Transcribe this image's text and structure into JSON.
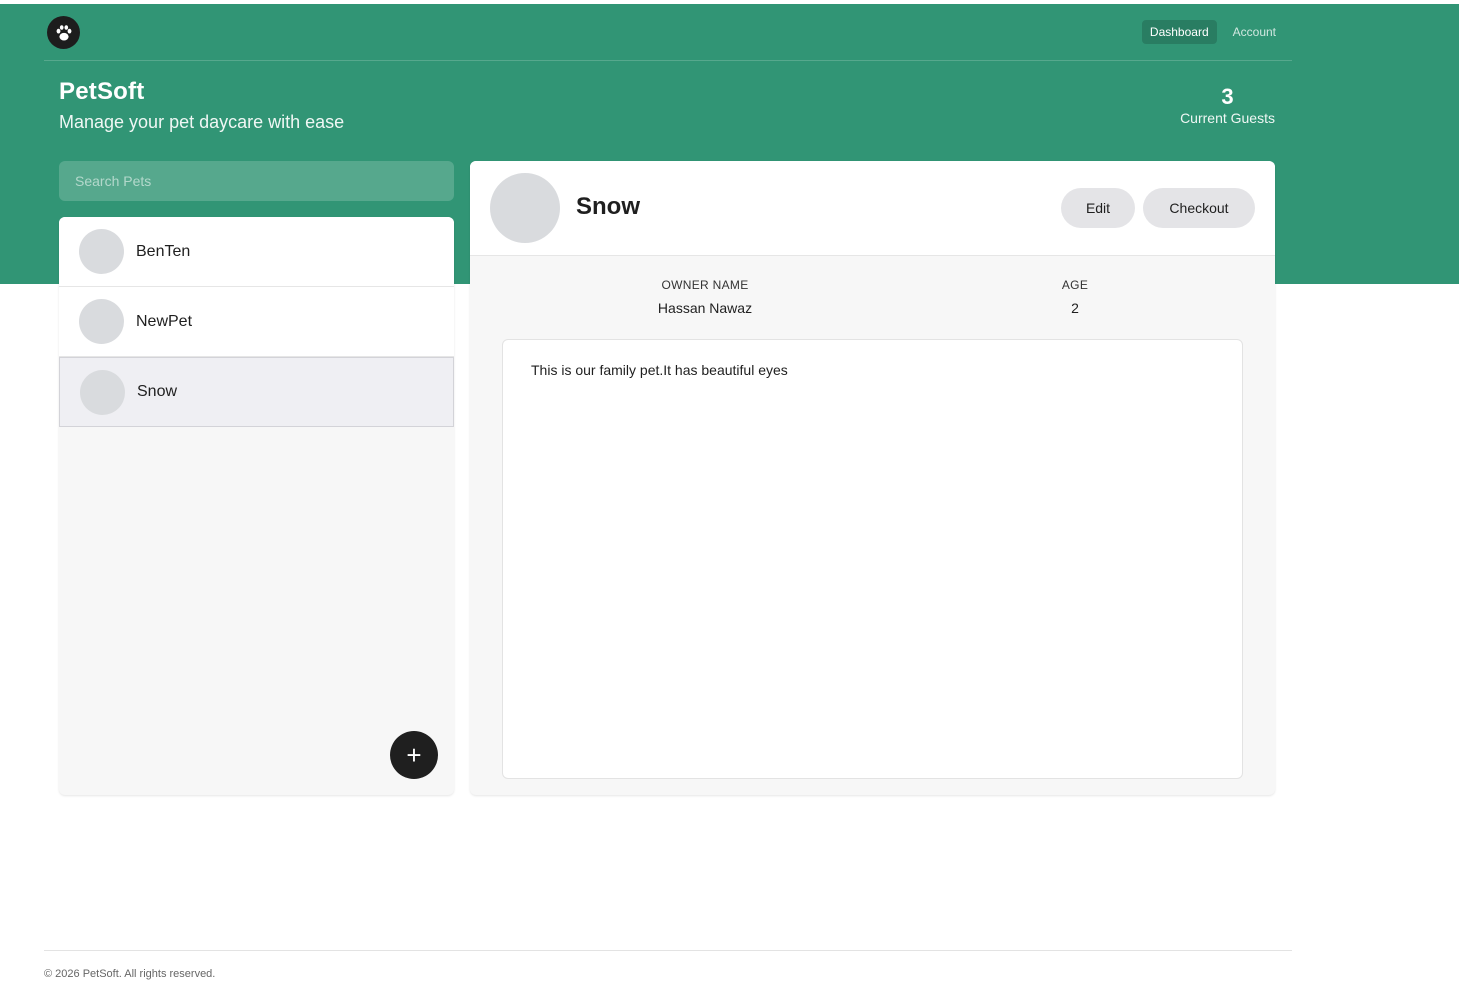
{
  "nav": {
    "logo_icon": "paw-icon",
    "links": [
      {
        "label": "Dashboard",
        "active": true
      },
      {
        "label": "Account",
        "active": false
      }
    ]
  },
  "header": {
    "title": "PetSoft",
    "subtitle": "Manage your pet daycare with ease"
  },
  "stats": {
    "count": "3",
    "label": "Current Guests"
  },
  "search": {
    "placeholder": "Search Pets",
    "value": ""
  },
  "pets": [
    {
      "name": "BenTen"
    },
    {
      "name": "NewPet"
    },
    {
      "name": "Snow"
    }
  ],
  "selected_pet": {
    "name": "Snow",
    "owner_label": "OWNER NAME",
    "owner_value": "Hassan Nawaz",
    "age_label": "AGE",
    "age_value": "2",
    "notes": "This is our family pet.It has beautiful eyes"
  },
  "actions": {
    "edit_label": "Edit",
    "checkout_label": "Checkout",
    "add_label": "+"
  },
  "footer": {
    "text": "© 2026 PetSoft. All rights reserved."
  },
  "colors": {
    "brand_green": "#319575",
    "dark": "#1f1f1f",
    "avatar_gray": "#d9dbde"
  }
}
